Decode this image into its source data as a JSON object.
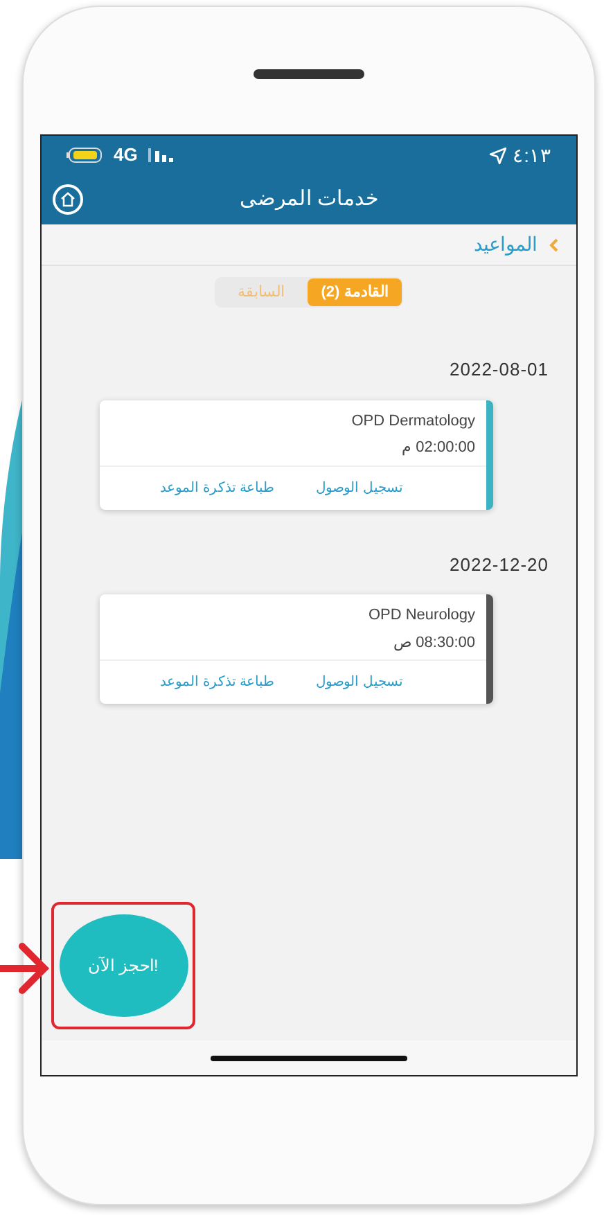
{
  "status_bar": {
    "network": "4G",
    "time": "٤:١٣"
  },
  "header": {
    "title": "خدمات المرضى"
  },
  "breadcrumb": {
    "label": "المواعيد"
  },
  "tabs": [
    {
      "label": "القادمة (2)",
      "selected": true
    },
    {
      "label": "السابقة",
      "selected": false
    }
  ],
  "appointments": [
    {
      "date": "2022-08-01",
      "clinic": "OPD Dermatology",
      "time": "02:00:00 م",
      "color": "#3bb3c3",
      "actions": [
        "تسجيل الوصول",
        "طباعة تذكرة الموعد"
      ]
    },
    {
      "date": "2022-12-20",
      "clinic": "OPD Neurology",
      "time": "08:30:00 ص",
      "color": "#555555",
      "actions": [
        "تسجيل الوصول",
        "طباعة تذكرة الموعد"
      ]
    }
  ],
  "book_button": {
    "label": "احجز الآن!"
  }
}
